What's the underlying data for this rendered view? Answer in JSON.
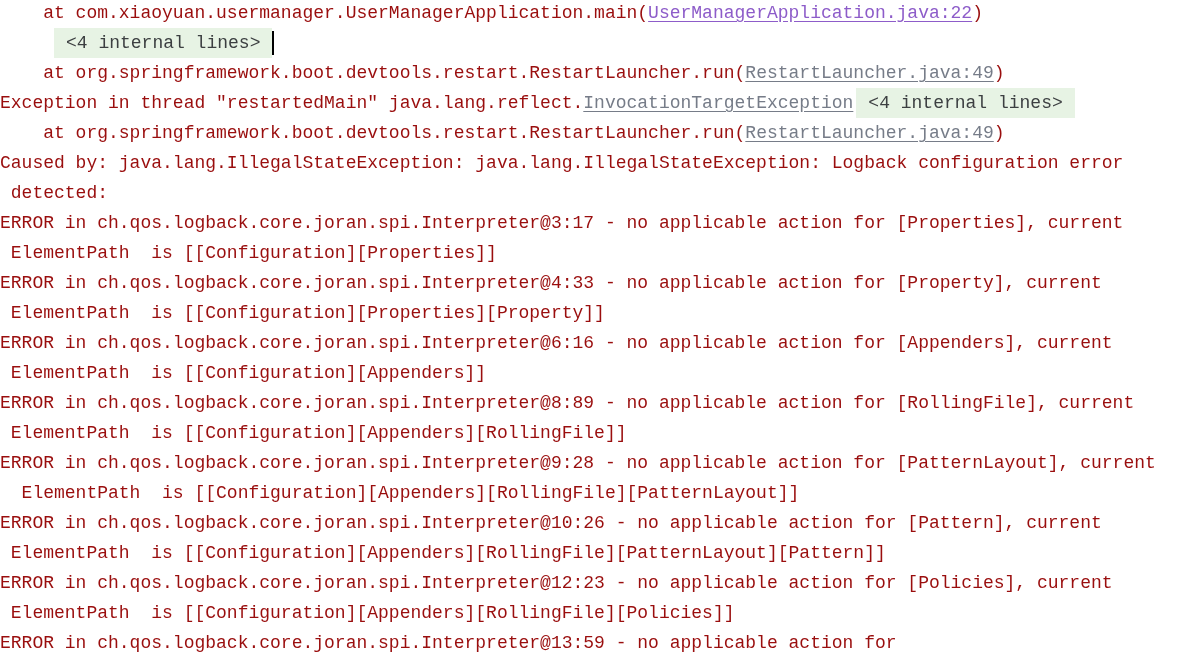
{
  "console": {
    "lines": [
      [
        {
          "kind": "text",
          "text": "    at com.xiaoyuan.usermanager.UserManagerApplication.main("
        },
        {
          "kind": "link",
          "text": "UserManagerApplication.java:22",
          "visited": true
        },
        {
          "kind": "text",
          "text": ")"
        }
      ],
      [
        {
          "kind": "folded",
          "text": "<4 internal lines>",
          "cursor": true
        }
      ],
      [
        {
          "kind": "text",
          "text": "    at org.springframework.boot.devtools.restart.RestartLauncher.run("
        },
        {
          "kind": "link",
          "text": "RestartLauncher.java:49",
          "visited": false
        },
        {
          "kind": "text",
          "text": ")"
        }
      ],
      [
        {
          "kind": "text",
          "text": "Exception in thread \"restartedMain\" java.lang.reflect."
        },
        {
          "kind": "link",
          "text": "InvocationTargetException",
          "visited": false
        },
        {
          "kind": "folded",
          "text": "<4 internal lines>",
          "cursor": false
        }
      ],
      [
        {
          "kind": "text",
          "text": "    at org.springframework.boot.devtools.restart.RestartLauncher.run("
        },
        {
          "kind": "link",
          "text": "RestartLauncher.java:49",
          "visited": false
        },
        {
          "kind": "text",
          "text": ")"
        }
      ],
      [
        {
          "kind": "text",
          "text": "Caused by: java.lang.IllegalStateException: java.lang.IllegalStateException: Logback configuration error"
        }
      ],
      [
        {
          "kind": "text",
          "text": " detected:"
        }
      ],
      [
        {
          "kind": "text",
          "text": "ERROR in ch.qos.logback.core.joran.spi.Interpreter@3:17 - no applicable action for [Properties], current"
        }
      ],
      [
        {
          "kind": "text",
          "text": " ElementPath  is [[Configuration][Properties]]"
        }
      ],
      [
        {
          "kind": "text",
          "text": "ERROR in ch.qos.logback.core.joran.spi.Interpreter@4:33 - no applicable action for [Property], current"
        }
      ],
      [
        {
          "kind": "text",
          "text": " ElementPath  is [[Configuration][Properties][Property]]"
        }
      ],
      [
        {
          "kind": "text",
          "text": "ERROR in ch.qos.logback.core.joran.spi.Interpreter@6:16 - no applicable action for [Appenders], current"
        }
      ],
      [
        {
          "kind": "text",
          "text": " ElementPath  is [[Configuration][Appenders]]"
        }
      ],
      [
        {
          "kind": "text",
          "text": "ERROR in ch.qos.logback.core.joran.spi.Interpreter@8:89 - no applicable action for [RollingFile], current"
        }
      ],
      [
        {
          "kind": "text",
          "text": " ElementPath  is [[Configuration][Appenders][RollingFile]]"
        }
      ],
      [
        {
          "kind": "text",
          "text": "ERROR in ch.qos.logback.core.joran.spi.Interpreter@9:28 - no applicable action for [PatternLayout], current"
        }
      ],
      [
        {
          "kind": "text",
          "text": "  ElementPath  is [[Configuration][Appenders][RollingFile][PatternLayout]]"
        }
      ],
      [
        {
          "kind": "text",
          "text": "ERROR in ch.qos.logback.core.joran.spi.Interpreter@10:26 - no applicable action for [Pattern], current"
        }
      ],
      [
        {
          "kind": "text",
          "text": " ElementPath  is [[Configuration][Appenders][RollingFile][PatternLayout][Pattern]]"
        }
      ],
      [
        {
          "kind": "text",
          "text": "ERROR in ch.qos.logback.core.joran.spi.Interpreter@12:23 - no applicable action for [Policies], current"
        }
      ],
      [
        {
          "kind": "text",
          "text": " ElementPath  is [[Configuration][Appenders][RollingFile][Policies]]"
        }
      ],
      [
        {
          "kind": "text",
          "text": "ERROR in ch.qos.logback.core.joran.spi.Interpreter@13:59 - no applicable action for"
        }
      ]
    ]
  }
}
